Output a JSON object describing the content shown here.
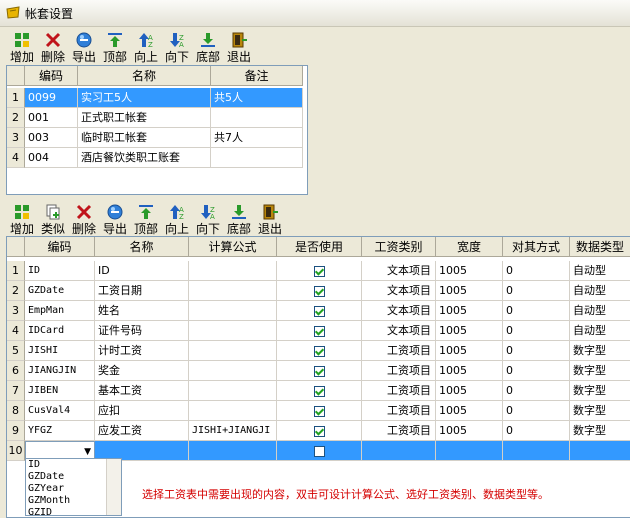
{
  "window": {
    "title": "帐套设置"
  },
  "toolbar_top": [
    {
      "label": "增加",
      "icon": "add-icon"
    },
    {
      "label": "删除",
      "icon": "delete-icon"
    },
    {
      "label": "导出",
      "icon": "export-icon"
    },
    {
      "label": "顶部",
      "icon": "top-icon"
    },
    {
      "label": "向上",
      "icon": "up-icon"
    },
    {
      "label": "向下",
      "icon": "down-icon"
    },
    {
      "label": "底部",
      "icon": "bottom-icon"
    },
    {
      "label": "退出",
      "icon": "exit-icon"
    }
  ],
  "accounts": {
    "headers": [
      "编码",
      "名称",
      "备注"
    ],
    "rows": [
      {
        "index": "1",
        "code": "0099",
        "name": "实习工5人",
        "note": "共5人",
        "selected": true
      },
      {
        "index": "2",
        "code": "001",
        "name": "正式职工帐套",
        "note": ""
      },
      {
        "index": "3",
        "code": "003",
        "name": "临时职工帐套",
        "note": "共7人"
      },
      {
        "index": "4",
        "code": "004",
        "name": "酒店餐饮类职工账套",
        "note": ""
      }
    ]
  },
  "toolbar_bottom": [
    {
      "label": "增加",
      "icon": "add-icon"
    },
    {
      "label": "类似",
      "icon": "similar-icon"
    },
    {
      "label": "删除",
      "icon": "delete-icon"
    },
    {
      "label": "导出",
      "icon": "export-icon"
    },
    {
      "label": "顶部",
      "icon": "top-icon"
    },
    {
      "label": "向上",
      "icon": "up-icon"
    },
    {
      "label": "向下",
      "icon": "down-icon"
    },
    {
      "label": "底部",
      "icon": "bottom-icon"
    },
    {
      "label": "退出",
      "icon": "exit-icon"
    }
  ],
  "fields": {
    "headers": [
      "编码",
      "名称",
      "计算公式",
      "是否使用",
      "工资类别",
      "宽度",
      "对其方式",
      "数据类型"
    ],
    "rows": [
      {
        "index": "1",
        "code": "ID",
        "name": "ID",
        "formula": "",
        "used": true,
        "category": "文本项目",
        "width": "1005",
        "align": "0",
        "dtype": "自动型"
      },
      {
        "index": "2",
        "code": "GZDate",
        "name": "工资日期",
        "formula": "",
        "used": true,
        "category": "文本项目",
        "width": "1005",
        "align": "0",
        "dtype": "自动型"
      },
      {
        "index": "3",
        "code": "EmpMan",
        "name": "姓名",
        "formula": "",
        "used": true,
        "category": "文本项目",
        "width": "1005",
        "align": "0",
        "dtype": "自动型"
      },
      {
        "index": "4",
        "code": "IDCard",
        "name": "证件号码",
        "formula": "",
        "used": true,
        "category": "文本项目",
        "width": "1005",
        "align": "0",
        "dtype": "自动型"
      },
      {
        "index": "5",
        "code": "JISHI",
        "name": "计时工资",
        "formula": "",
        "used": true,
        "category": "工资项目",
        "width": "1005",
        "align": "0",
        "dtype": "数字型"
      },
      {
        "index": "6",
        "code": "JIANGJIN",
        "name": "奖金",
        "formula": "",
        "used": true,
        "category": "工资项目",
        "width": "1005",
        "align": "0",
        "dtype": "数字型"
      },
      {
        "index": "7",
        "code": "JIBEN",
        "name": "基本工资",
        "formula": "",
        "used": true,
        "category": "工资项目",
        "width": "1005",
        "align": "0",
        "dtype": "数字型"
      },
      {
        "index": "8",
        "code": "CusVal4",
        "name": "应扣",
        "formula": "",
        "used": true,
        "category": "工资项目",
        "width": "1005",
        "align": "0",
        "dtype": "数字型"
      },
      {
        "index": "9",
        "code": "YFGZ",
        "name": "应发工资",
        "formula": "JISHI+JIANGJI",
        "used": true,
        "category": "工资项目",
        "width": "1005",
        "align": "0",
        "dtype": "数字型"
      }
    ],
    "new_row": {
      "index": "10",
      "used": false
    }
  },
  "dropdown_options": [
    "ID",
    "GZDate",
    "GZYear",
    "GZMonth",
    "GZID"
  ],
  "hint": "选择工资表中需要出现的内容，双击可设计计算公式、选好工资类别、数据类型等。"
}
